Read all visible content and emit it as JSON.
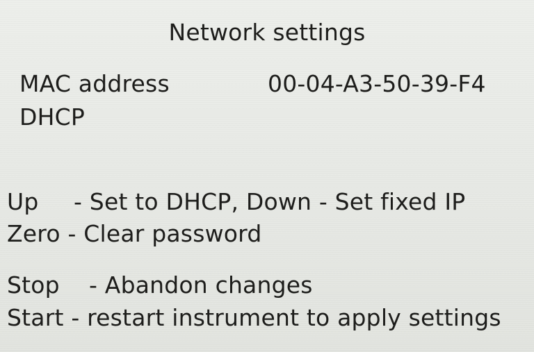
{
  "screen": {
    "title": "Network settings",
    "fields": {
      "mac_label": "MAC address",
      "mac_value": "00-04-A3-50-39-F4",
      "dhcp_label": "DHCP"
    },
    "keys": {
      "up_key": "Up",
      "up_action": "- Set to DHCP,  Down - Set fixed IP",
      "zero_key": "Zero",
      "zero_action": " - Clear password",
      "stop_key": "Stop",
      "stop_action": "- Abandon changes",
      "start_key": "Start",
      "start_action": " - restart instrument to apply settings"
    }
  }
}
